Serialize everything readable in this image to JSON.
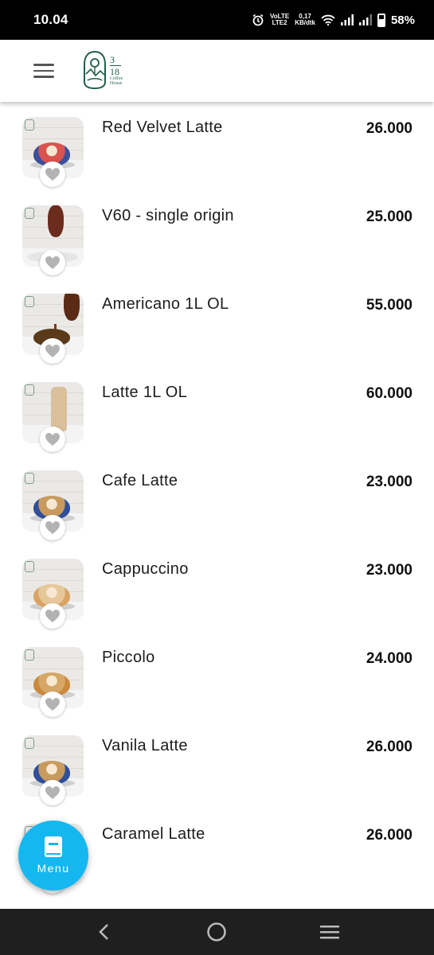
{
  "status": {
    "time": "10.04",
    "network_type_top": "VoLTE",
    "network_type_bottom": "LTE2",
    "speed_value": "0,17",
    "speed_unit": "KB/dtk",
    "battery": "58%"
  },
  "header": {
    "menu_icon": "hamburger-icon",
    "logo_numbers_top": "3",
    "logo_numbers_bottom": "18",
    "logo_tagline_1": "Coffee",
    "logo_tagline_2": "House"
  },
  "menu_items": [
    {
      "name": "Red Velvet Latte",
      "price": "26.000",
      "cup_color": "#d9534f",
      "cup_base": "#3b4f9a"
    },
    {
      "name": "V60 - single origin",
      "price": "25.000",
      "cup_color": "#6b2c1e",
      "cup_base": "#6b2c1e"
    },
    {
      "name": "Americano 1L OL",
      "price": "55.000",
      "cup_color": "#7a4a20",
      "cup_base": "#5a3a1a"
    },
    {
      "name": "Latte 1L OL",
      "price": "60.000",
      "cup_color": "#d9bf9b",
      "cup_base": "#d9bf9b"
    },
    {
      "name": "Cafe Latte",
      "price": "23.000",
      "cup_color": "#c89a5e",
      "cup_base": "#2f4f9a"
    },
    {
      "name": "Cappuccino",
      "price": "23.000",
      "cup_color": "#e6c79a",
      "cup_base": "#d9a463"
    },
    {
      "name": "Piccolo",
      "price": "24.000",
      "cup_color": "#d6a766",
      "cup_base": "#c98a3e"
    },
    {
      "name": "Vanila Latte",
      "price": "26.000",
      "cup_color": "#c89a5e",
      "cup_base": "#2f4f9a"
    },
    {
      "name": "Caramel Latte",
      "price": "26.000",
      "cup_color": "#c89a5e",
      "cup_base": "#8a6a4a"
    }
  ],
  "fab": {
    "label": "Menu",
    "icon": "book-icon",
    "color": "#14b7f0"
  },
  "nav": {
    "back_icon": "back-icon",
    "home_icon": "home-icon",
    "recents_icon": "recents-icon"
  }
}
